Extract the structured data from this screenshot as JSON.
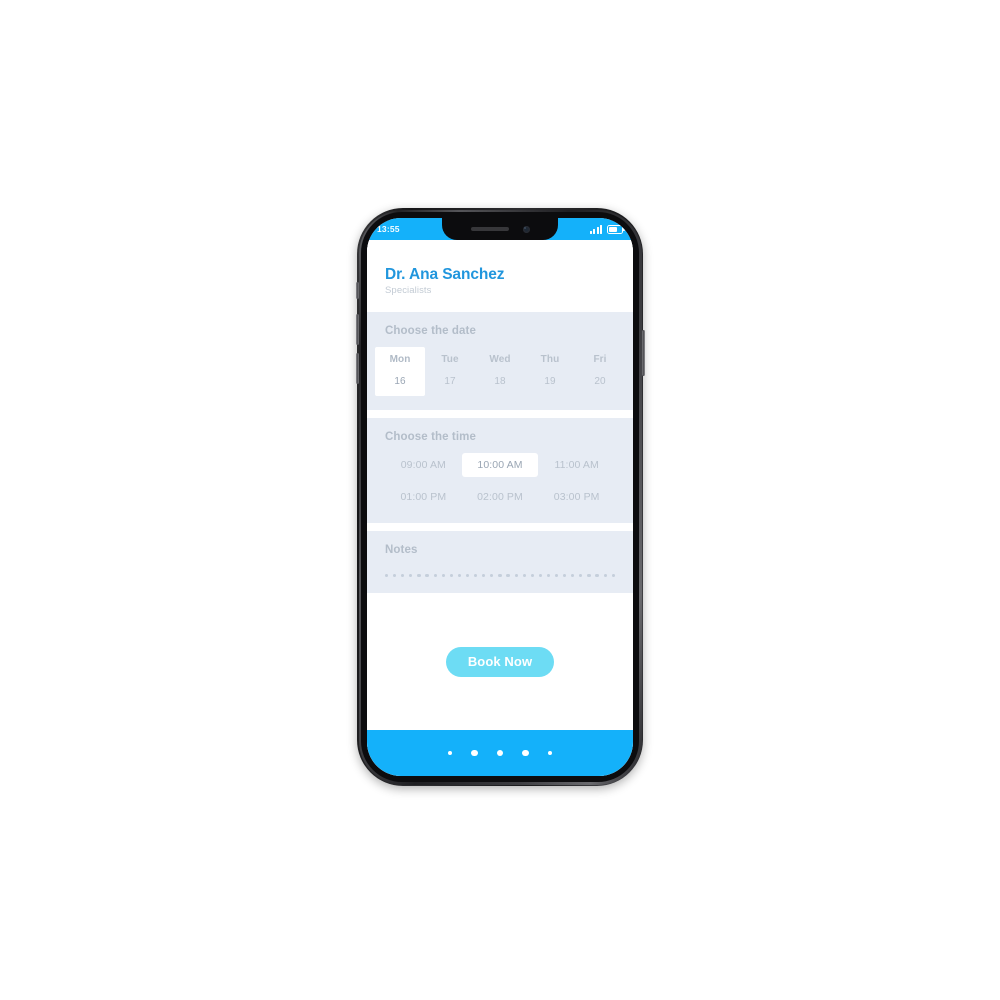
{
  "device": {
    "type": "smartphone-mockup",
    "frame_color": "#1a1a1c"
  },
  "status_bar": {
    "time": "13:55",
    "signal_icon": "signal-bars-icon",
    "battery_icon": "battery-icon",
    "background": "#14b1fa"
  },
  "header": {
    "doctor_name": "Dr. Ana Sanchez",
    "doctor_role": "Specialists",
    "name_color": "#2196dd",
    "role_color": "#c3cbd4"
  },
  "date_section": {
    "title": "Choose the date",
    "days": [
      {
        "dow": "Mon",
        "num": "16",
        "selected": true
      },
      {
        "dow": "Tue",
        "num": "17",
        "selected": false
      },
      {
        "dow": "Wed",
        "num": "18",
        "selected": false
      },
      {
        "dow": "Thu",
        "num": "19",
        "selected": false
      },
      {
        "dow": "Fri",
        "num": "20",
        "selected": false
      }
    ]
  },
  "time_section": {
    "title": "Choose the time",
    "slots": [
      {
        "label": "09:00 AM",
        "selected": false
      },
      {
        "label": "10:00 AM",
        "selected": true
      },
      {
        "label": "11:00 AM",
        "selected": false
      },
      {
        "label": "01:00 PM",
        "selected": false
      },
      {
        "label": "02:00 PM",
        "selected": false
      },
      {
        "label": "03:00 PM",
        "selected": false
      }
    ]
  },
  "notes_section": {
    "title": "Notes",
    "placeholder_dot_count": 29
  },
  "cta": {
    "book_label": "Book Now",
    "button_color": "#6ddcf4"
  },
  "bottom_bar": {
    "background": "#14b1fa",
    "dots": [
      "sm",
      "lg",
      "lg",
      "lg",
      "sm"
    ]
  },
  "colors": {
    "accent_blue": "#14b1fa",
    "panel_bg": "#e7ecf4",
    "muted_text": "#b9c2cd"
  }
}
